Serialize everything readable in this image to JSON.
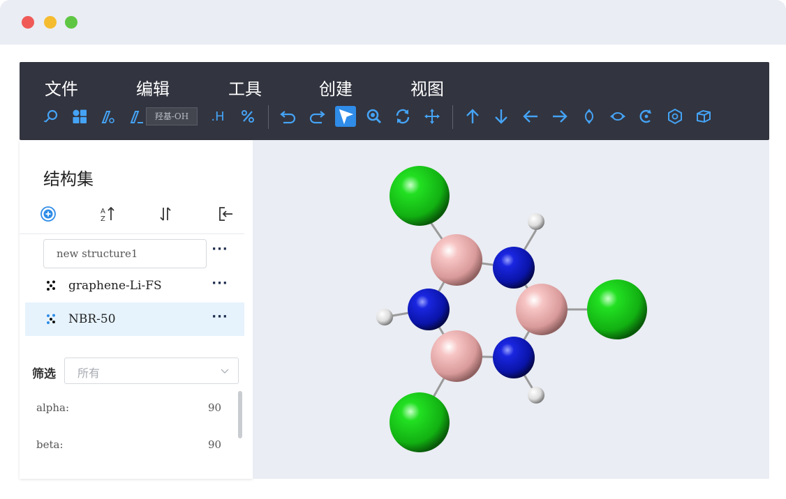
{
  "menu": {
    "items": [
      {
        "label": "文件"
      },
      {
        "label": "编辑"
      },
      {
        "label": "工具"
      },
      {
        "label": "创建"
      },
      {
        "label": "视图"
      }
    ]
  },
  "toolbar": {
    "group_input_value": "羟基-OH",
    "add_h_label": ".H",
    "icons": [
      "search-atom-icon",
      "grid-icon",
      "draw-bond-icon",
      "add-group-icon",
      "add-hydrogen-icon",
      "percent-icon",
      "undo-icon",
      "redo-icon",
      "select-icon",
      "zoom-icon",
      "rotate-icon",
      "move-icon",
      "arrow-up-icon",
      "arrow-down-icon",
      "arrow-left-icon",
      "arrow-right-icon",
      "vertical-flip-icon",
      "horizontal-flip-icon",
      "rotate-c-icon",
      "hexagon-icon",
      "cube-icon"
    ]
  },
  "sidebar": {
    "title": "结构集",
    "structures": [
      {
        "name": "new structure1",
        "editing": true
      },
      {
        "name": "graphene-Li-FS",
        "editing": false
      },
      {
        "name": "NBR-50",
        "editing": false,
        "selected": true
      }
    ],
    "more_label": "···",
    "filter": {
      "label": "筛选",
      "value": "所有"
    },
    "params": [
      {
        "name": "alpha:",
        "value": "90"
      },
      {
        "name": "beta:",
        "value": "90"
      }
    ]
  },
  "colors": {
    "accent": "#2f8ce8",
    "toolbar_bg": "#32343f",
    "selected_row": "#e6f3fd",
    "boron": "#f4b6b6",
    "nitrogen": "#0b16c8",
    "chlorine": "#16d616",
    "hydrogen": "#ffffff"
  }
}
